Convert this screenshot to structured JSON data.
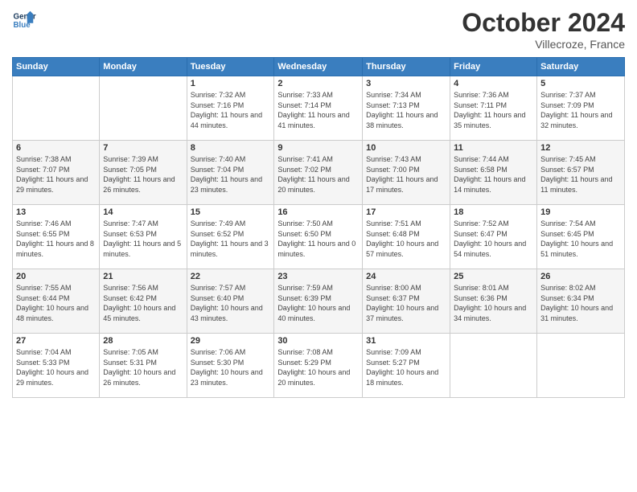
{
  "header": {
    "logo_line1": "General",
    "logo_line2": "Blue",
    "month_title": "October 2024",
    "location": "Villecroze, France"
  },
  "weekdays": [
    "Sunday",
    "Monday",
    "Tuesday",
    "Wednesday",
    "Thursday",
    "Friday",
    "Saturday"
  ],
  "weeks": [
    [
      {
        "day": "",
        "sunrise": "",
        "sunset": "",
        "daylight": ""
      },
      {
        "day": "",
        "sunrise": "",
        "sunset": "",
        "daylight": ""
      },
      {
        "day": "1",
        "sunrise": "Sunrise: 7:32 AM",
        "sunset": "Sunset: 7:16 PM",
        "daylight": "Daylight: 11 hours and 44 minutes."
      },
      {
        "day": "2",
        "sunrise": "Sunrise: 7:33 AM",
        "sunset": "Sunset: 7:14 PM",
        "daylight": "Daylight: 11 hours and 41 minutes."
      },
      {
        "day": "3",
        "sunrise": "Sunrise: 7:34 AM",
        "sunset": "Sunset: 7:13 PM",
        "daylight": "Daylight: 11 hours and 38 minutes."
      },
      {
        "day": "4",
        "sunrise": "Sunrise: 7:36 AM",
        "sunset": "Sunset: 7:11 PM",
        "daylight": "Daylight: 11 hours and 35 minutes."
      },
      {
        "day": "5",
        "sunrise": "Sunrise: 7:37 AM",
        "sunset": "Sunset: 7:09 PM",
        "daylight": "Daylight: 11 hours and 32 minutes."
      }
    ],
    [
      {
        "day": "6",
        "sunrise": "Sunrise: 7:38 AM",
        "sunset": "Sunset: 7:07 PM",
        "daylight": "Daylight: 11 hours and 29 minutes."
      },
      {
        "day": "7",
        "sunrise": "Sunrise: 7:39 AM",
        "sunset": "Sunset: 7:05 PM",
        "daylight": "Daylight: 11 hours and 26 minutes."
      },
      {
        "day": "8",
        "sunrise": "Sunrise: 7:40 AM",
        "sunset": "Sunset: 7:04 PM",
        "daylight": "Daylight: 11 hours and 23 minutes."
      },
      {
        "day": "9",
        "sunrise": "Sunrise: 7:41 AM",
        "sunset": "Sunset: 7:02 PM",
        "daylight": "Daylight: 11 hours and 20 minutes."
      },
      {
        "day": "10",
        "sunrise": "Sunrise: 7:43 AM",
        "sunset": "Sunset: 7:00 PM",
        "daylight": "Daylight: 11 hours and 17 minutes."
      },
      {
        "day": "11",
        "sunrise": "Sunrise: 7:44 AM",
        "sunset": "Sunset: 6:58 PM",
        "daylight": "Daylight: 11 hours and 14 minutes."
      },
      {
        "day": "12",
        "sunrise": "Sunrise: 7:45 AM",
        "sunset": "Sunset: 6:57 PM",
        "daylight": "Daylight: 11 hours and 11 minutes."
      }
    ],
    [
      {
        "day": "13",
        "sunrise": "Sunrise: 7:46 AM",
        "sunset": "Sunset: 6:55 PM",
        "daylight": "Daylight: 11 hours and 8 minutes."
      },
      {
        "day": "14",
        "sunrise": "Sunrise: 7:47 AM",
        "sunset": "Sunset: 6:53 PM",
        "daylight": "Daylight: 11 hours and 5 minutes."
      },
      {
        "day": "15",
        "sunrise": "Sunrise: 7:49 AM",
        "sunset": "Sunset: 6:52 PM",
        "daylight": "Daylight: 11 hours and 3 minutes."
      },
      {
        "day": "16",
        "sunrise": "Sunrise: 7:50 AM",
        "sunset": "Sunset: 6:50 PM",
        "daylight": "Daylight: 11 hours and 0 minutes."
      },
      {
        "day": "17",
        "sunrise": "Sunrise: 7:51 AM",
        "sunset": "Sunset: 6:48 PM",
        "daylight": "Daylight: 10 hours and 57 minutes."
      },
      {
        "day": "18",
        "sunrise": "Sunrise: 7:52 AM",
        "sunset": "Sunset: 6:47 PM",
        "daylight": "Daylight: 10 hours and 54 minutes."
      },
      {
        "day": "19",
        "sunrise": "Sunrise: 7:54 AM",
        "sunset": "Sunset: 6:45 PM",
        "daylight": "Daylight: 10 hours and 51 minutes."
      }
    ],
    [
      {
        "day": "20",
        "sunrise": "Sunrise: 7:55 AM",
        "sunset": "Sunset: 6:44 PM",
        "daylight": "Daylight: 10 hours and 48 minutes."
      },
      {
        "day": "21",
        "sunrise": "Sunrise: 7:56 AM",
        "sunset": "Sunset: 6:42 PM",
        "daylight": "Daylight: 10 hours and 45 minutes."
      },
      {
        "day": "22",
        "sunrise": "Sunrise: 7:57 AM",
        "sunset": "Sunset: 6:40 PM",
        "daylight": "Daylight: 10 hours and 43 minutes."
      },
      {
        "day": "23",
        "sunrise": "Sunrise: 7:59 AM",
        "sunset": "Sunset: 6:39 PM",
        "daylight": "Daylight: 10 hours and 40 minutes."
      },
      {
        "day": "24",
        "sunrise": "Sunrise: 8:00 AM",
        "sunset": "Sunset: 6:37 PM",
        "daylight": "Daylight: 10 hours and 37 minutes."
      },
      {
        "day": "25",
        "sunrise": "Sunrise: 8:01 AM",
        "sunset": "Sunset: 6:36 PM",
        "daylight": "Daylight: 10 hours and 34 minutes."
      },
      {
        "day": "26",
        "sunrise": "Sunrise: 8:02 AM",
        "sunset": "Sunset: 6:34 PM",
        "daylight": "Daylight: 10 hours and 31 minutes."
      }
    ],
    [
      {
        "day": "27",
        "sunrise": "Sunrise: 7:04 AM",
        "sunset": "Sunset: 5:33 PM",
        "daylight": "Daylight: 10 hours and 29 minutes."
      },
      {
        "day": "28",
        "sunrise": "Sunrise: 7:05 AM",
        "sunset": "Sunset: 5:31 PM",
        "daylight": "Daylight: 10 hours and 26 minutes."
      },
      {
        "day": "29",
        "sunrise": "Sunrise: 7:06 AM",
        "sunset": "Sunset: 5:30 PM",
        "daylight": "Daylight: 10 hours and 23 minutes."
      },
      {
        "day": "30",
        "sunrise": "Sunrise: 7:08 AM",
        "sunset": "Sunset: 5:29 PM",
        "daylight": "Daylight: 10 hours and 20 minutes."
      },
      {
        "day": "31",
        "sunrise": "Sunrise: 7:09 AM",
        "sunset": "Sunset: 5:27 PM",
        "daylight": "Daylight: 10 hours and 18 minutes."
      },
      {
        "day": "",
        "sunrise": "",
        "sunset": "",
        "daylight": ""
      },
      {
        "day": "",
        "sunrise": "",
        "sunset": "",
        "daylight": ""
      }
    ]
  ]
}
